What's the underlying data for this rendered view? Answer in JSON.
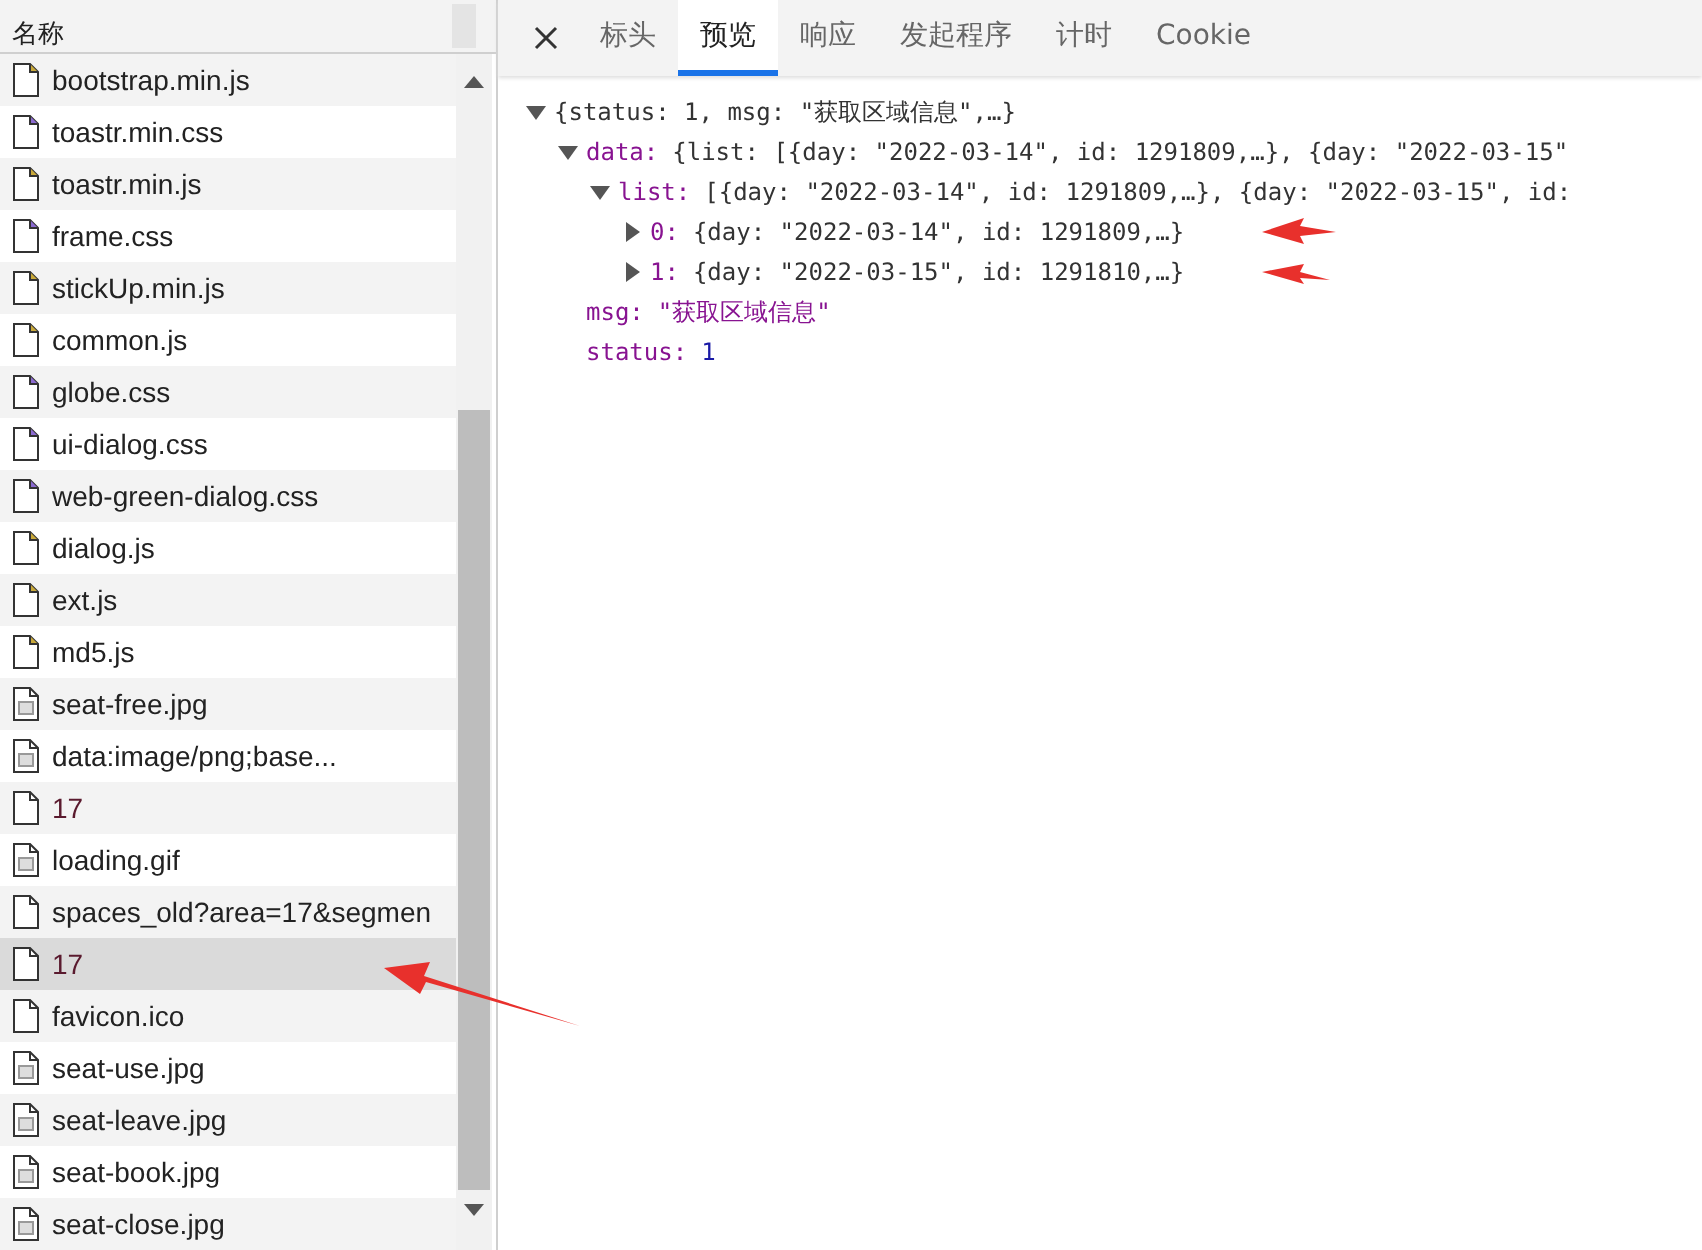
{
  "request_list": {
    "header": "名称",
    "rows": [
      {
        "name": "bootstrap.min.js",
        "kind": "script",
        "selected": false
      },
      {
        "name": "toastr.min.css",
        "kind": "stylesheet",
        "selected": false
      },
      {
        "name": "toastr.min.js",
        "kind": "script",
        "selected": false
      },
      {
        "name": "frame.css",
        "kind": "stylesheet",
        "selected": false
      },
      {
        "name": "stickUp.min.js",
        "kind": "script",
        "selected": false
      },
      {
        "name": "common.js",
        "kind": "script",
        "selected": false
      },
      {
        "name": "globe.css",
        "kind": "stylesheet",
        "selected": false
      },
      {
        "name": "ui-dialog.css",
        "kind": "stylesheet",
        "selected": false
      },
      {
        "name": "web-green-dialog.css",
        "kind": "stylesheet",
        "selected": false
      },
      {
        "name": "dialog.js",
        "kind": "script",
        "selected": false
      },
      {
        "name": "ext.js",
        "kind": "script",
        "selected": false
      },
      {
        "name": "md5.js",
        "kind": "script",
        "selected": false
      },
      {
        "name": "seat-free.jpg",
        "kind": "image",
        "selected": false
      },
      {
        "name": "data:image/png;base...",
        "kind": "image",
        "selected": false
      },
      {
        "name": "17",
        "kind": "xhr",
        "selected": false
      },
      {
        "name": "loading.gif",
        "kind": "image",
        "selected": false
      },
      {
        "name": "spaces_old?area=17&segmen",
        "kind": "document",
        "selected": false
      },
      {
        "name": "17",
        "kind": "xhr",
        "selected": true
      },
      {
        "name": "favicon.ico",
        "kind": "document",
        "selected": false
      },
      {
        "name": "seat-use.jpg",
        "kind": "image",
        "selected": false
      },
      {
        "name": "seat-leave.jpg",
        "kind": "image",
        "selected": false
      },
      {
        "name": "seat-book.jpg",
        "kind": "image",
        "selected": false
      },
      {
        "name": "seat-close.jpg",
        "kind": "image",
        "selected": false
      }
    ]
  },
  "detail_tabs": [
    {
      "label": "标头",
      "selected": false
    },
    {
      "label": "预览",
      "selected": true
    },
    {
      "label": "响应",
      "selected": false
    },
    {
      "label": "发起程序",
      "selected": false
    },
    {
      "label": "计时",
      "selected": false
    },
    {
      "label": "Cookie",
      "selected": false
    }
  ],
  "preview_tree": [
    {
      "value": "{status: 1, msg: \"获取区域信息\",…}",
      "kind": "object",
      "expanded": true,
      "children": [
        {
          "key": "data:",
          "value": "{list: [{day: \"2022-03-14\", id: 1291809,…}, {day: \"2022-03-15\"",
          "kind": "object",
          "expanded": true,
          "children": [
            {
              "key": "list:",
              "value": "[{day: \"2022-03-14\", id: 1291809,…}, {day: \"2022-03-15\", id:",
              "kind": "object",
              "expanded": true,
              "children": [
                {
                  "key": "0:",
                  "value": "{day: \"2022-03-14\", id: 1291809,…}",
                  "kind": "object",
                  "expanded": false
                },
                {
                  "key": "1:",
                  "value": "{day: \"2022-03-15\", id: 1291810,…}",
                  "kind": "object",
                  "expanded": false
                }
              ]
            }
          ]
        },
        {
          "key": "msg:",
          "value": "\"获取区域信息\"",
          "kind": "string"
        },
        {
          "key": "status:",
          "value": "1",
          "kind": "number"
        }
      ]
    }
  ]
}
